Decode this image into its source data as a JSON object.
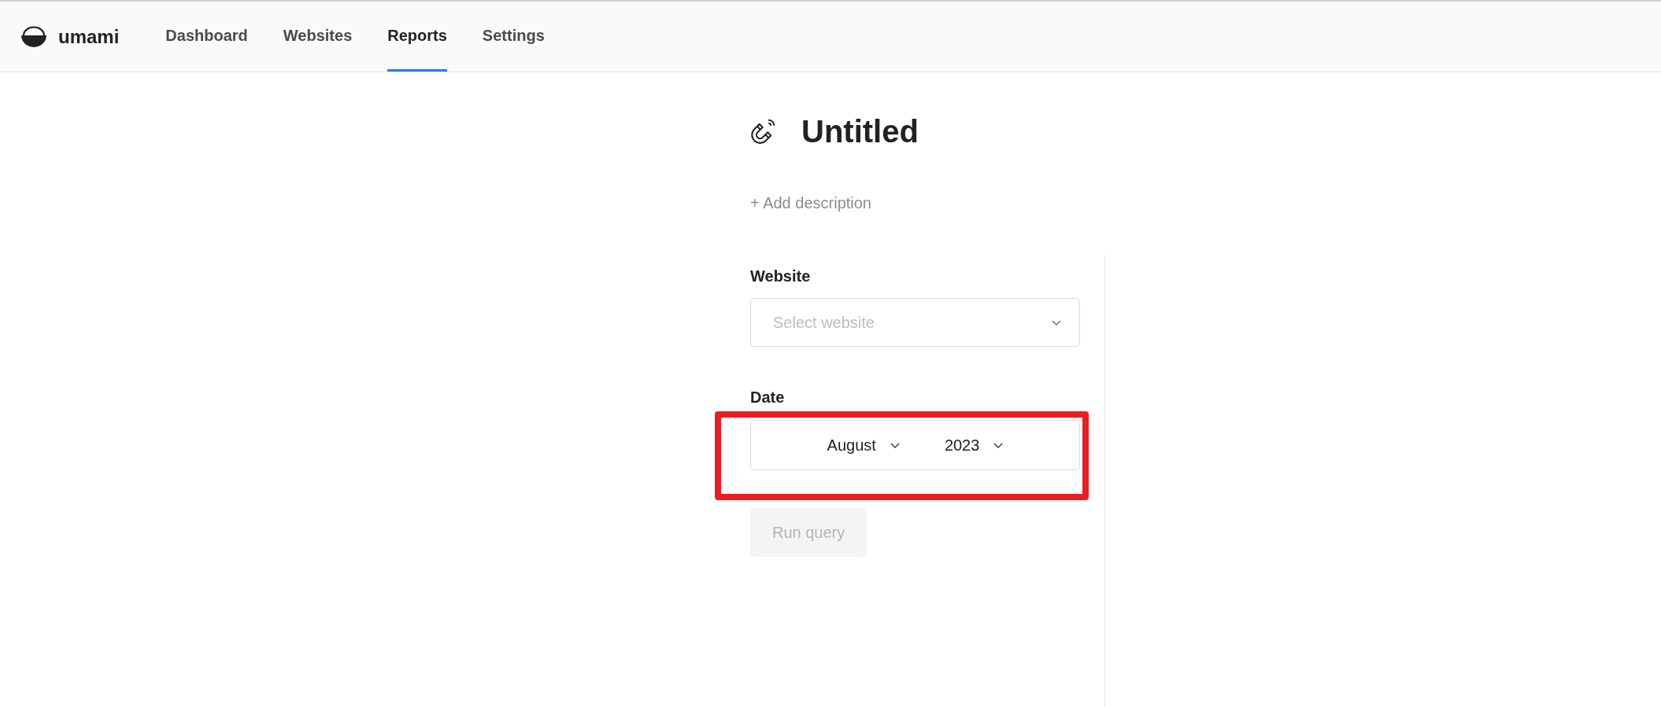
{
  "header": {
    "brand": "umami",
    "nav": [
      {
        "label": "Dashboard",
        "selected": false
      },
      {
        "label": "Websites",
        "selected": false
      },
      {
        "label": "Reports",
        "selected": true
      },
      {
        "label": "Settings",
        "selected": false
      }
    ]
  },
  "report": {
    "title": "Untitled",
    "add_description": "+ Add description"
  },
  "parameters": {
    "website": {
      "label": "Website",
      "placeholder": "Select website"
    },
    "date": {
      "label": "Date",
      "month": "August",
      "year": "2023"
    },
    "run_button": {
      "label": "Run query",
      "disabled": true
    }
  }
}
